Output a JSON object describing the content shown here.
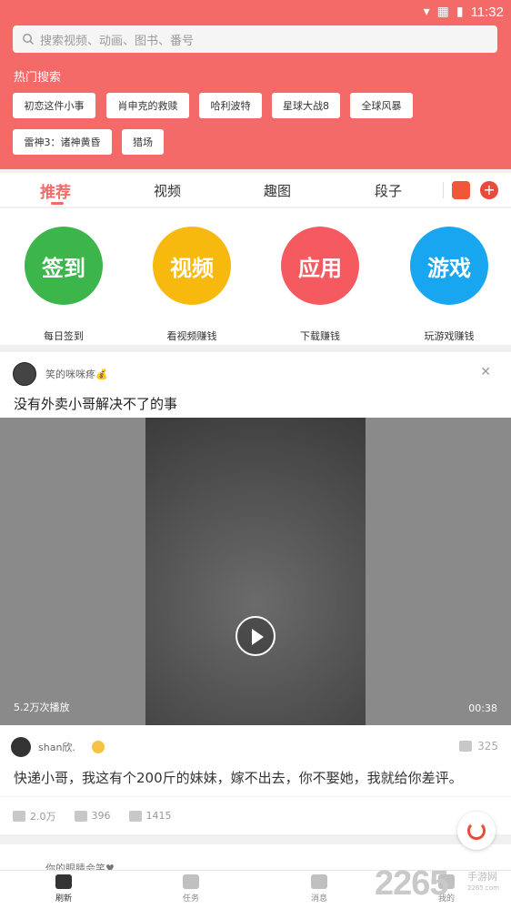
{
  "status_bar": {
    "time": "11:32"
  },
  "search": {
    "placeholder": "搜索视频、动画、图书、番号"
  },
  "hot_search": {
    "title": "热门搜索",
    "chips": [
      "初恋这件小事",
      "肖申克的救赎",
      "哈利波特",
      "星球大战8",
      "全球风暴",
      "雷神3：诸神黄昏",
      "猎场"
    ]
  },
  "tabs": [
    "推荐",
    "视频",
    "趣图",
    "段子"
  ],
  "quick_actions": [
    {
      "icon_text": "签到",
      "label": "每日签到",
      "color": "#3cb54a"
    },
    {
      "icon_text": "视频",
      "label": "看视频赚钱",
      "color": "#f7b90d"
    },
    {
      "icon_text": "应用",
      "label": "下载赚钱",
      "color": "#f45a5f"
    },
    {
      "icon_text": "游戏",
      "label": "玩游戏赚钱",
      "color": "#17a6ef"
    }
  ],
  "post": {
    "username": "笑的咪咪疼💰",
    "title": "没有外卖小哥解决不了的事",
    "views": "5.2万次播放",
    "duration": "00:38",
    "top_comment": {
      "username": "shan欣.",
      "likes": "325",
      "text": "快递小哥，我这有个200斤的妹妹，嫁不出去，你不娶她，我就给你差评。"
    },
    "stats": {
      "likes": "2.0万",
      "dislikes": "396",
      "comments": "1415"
    }
  },
  "next_post": {
    "username": "你的眼睛会笑♥"
  },
  "bottom_nav": [
    "刷新",
    "任务",
    "消息",
    "我的"
  ],
  "watermark": {
    "logo": "2265",
    "sub": "手游网",
    "url": "2265.com"
  }
}
